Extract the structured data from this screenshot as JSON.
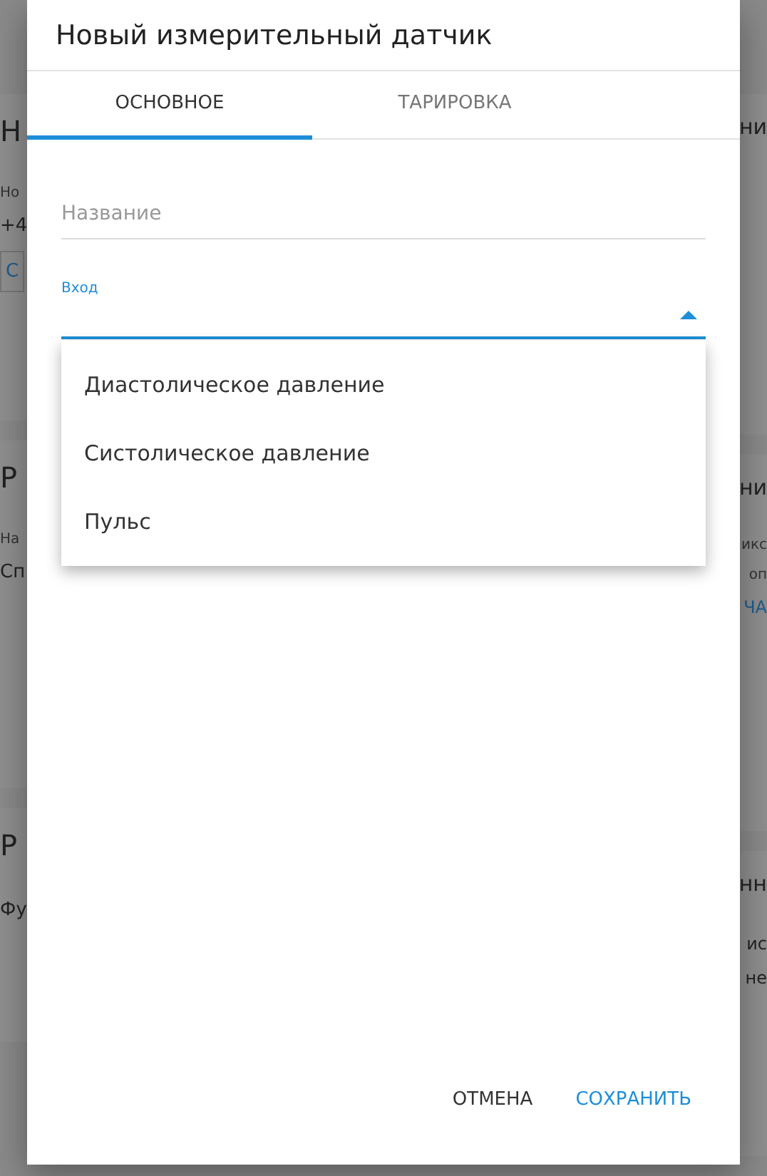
{
  "background": {
    "left_sections": [
      {
        "items": [
          {
            "kind": "heading",
            "text": "Н"
          },
          {
            "kind": "label",
            "text": "Но"
          },
          {
            "kind": "text",
            "text": "+4"
          },
          {
            "kind": "button",
            "text": "С"
          }
        ]
      },
      {
        "items": [
          {
            "kind": "heading",
            "text": "Р"
          },
          {
            "kind": "label",
            "text": "На"
          },
          {
            "kind": "text",
            "text": "Сп"
          }
        ]
      },
      {
        "items": [
          {
            "kind": "heading",
            "text": "Р"
          },
          {
            "kind": "text",
            "text": "Фу"
          }
        ]
      }
    ],
    "right_sections": [
      {
        "items": [
          {
            "kind": "heading",
            "text": "ни"
          }
        ]
      },
      {
        "items": [
          {
            "kind": "heading",
            "text": "ни"
          },
          {
            "kind": "label",
            "text": "икс"
          },
          {
            "kind": "label",
            "text": "оп"
          },
          {
            "kind": "link",
            "text": "ЧА"
          }
        ]
      },
      {
        "items": [
          {
            "kind": "heading",
            "text": "нн"
          },
          {
            "kind": "text",
            "text": "ис"
          },
          {
            "kind": "text",
            "text": "не"
          }
        ]
      }
    ]
  },
  "dialog": {
    "title": "Новый измерительный датчик",
    "tabs": [
      {
        "label": "ОСНОВНОЕ",
        "selected": true
      },
      {
        "label": "ТАРИРОВКА",
        "selected": false
      }
    ],
    "fields": [
      {
        "kind": "text",
        "placeholder": "Название"
      },
      {
        "kind": "select",
        "label": "Вход",
        "expanded": true,
        "options": [
          "Диастолическое давление",
          "Систолическое давление",
          "Пульс"
        ]
      }
    ],
    "buttons": [
      {
        "label": "ОТМЕНА",
        "kind": "secondary"
      },
      {
        "label": "СОХРАНИТЬ",
        "kind": "primary"
      }
    ]
  }
}
